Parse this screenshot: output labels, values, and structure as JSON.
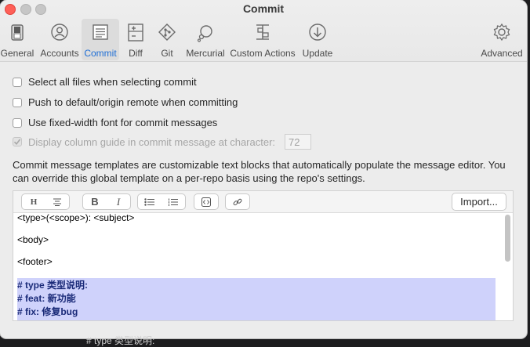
{
  "window": {
    "title": "Commit"
  },
  "toolbar": {
    "items": [
      {
        "label": "General",
        "icon": "general-switch-icon"
      },
      {
        "label": "Accounts",
        "icon": "accounts-person-icon"
      },
      {
        "label": "Commit",
        "icon": "commit-document-icon",
        "active": true
      },
      {
        "label": "Diff",
        "icon": "diff-icon"
      },
      {
        "label": "Git",
        "icon": "git-icon"
      },
      {
        "label": "Mercurial",
        "icon": "mercurial-icon"
      },
      {
        "label": "Custom Actions",
        "icon": "custom-actions-icon"
      },
      {
        "label": "Update",
        "icon": "update-icon"
      },
      {
        "label": "Advanced",
        "icon": "gear-icon"
      }
    ],
    "accent": "#1f6fd6"
  },
  "options": {
    "select_all": {
      "label": "Select all files when selecting commit",
      "checked": false
    },
    "push_default": {
      "label": "Push to default/origin remote when committing",
      "checked": false
    },
    "fixed_width": {
      "label": "Use fixed-width font for commit messages",
      "checked": false
    },
    "column_guide": {
      "label": "Display column guide in commit message at character:",
      "checked": true,
      "enabled": false,
      "value": "72"
    }
  },
  "description": "Commit message templates are customizable text blocks that automatically populate the message editor. You can override this global template on a per-repo basis using the repo's settings.",
  "editor": {
    "import_label": "Import...",
    "format_buttons": [
      "H",
      "B",
      "I"
    ],
    "lines": [
      "<type>(<scope>): <subject>",
      "<body>",
      "<footer>"
    ],
    "comment_lines": [
      "# type 类型说明:",
      "# feat: 新功能",
      "# fix: 修复bug"
    ],
    "highlight_color": "#cfd2fb"
  },
  "background_text": "# type 类型说明:"
}
